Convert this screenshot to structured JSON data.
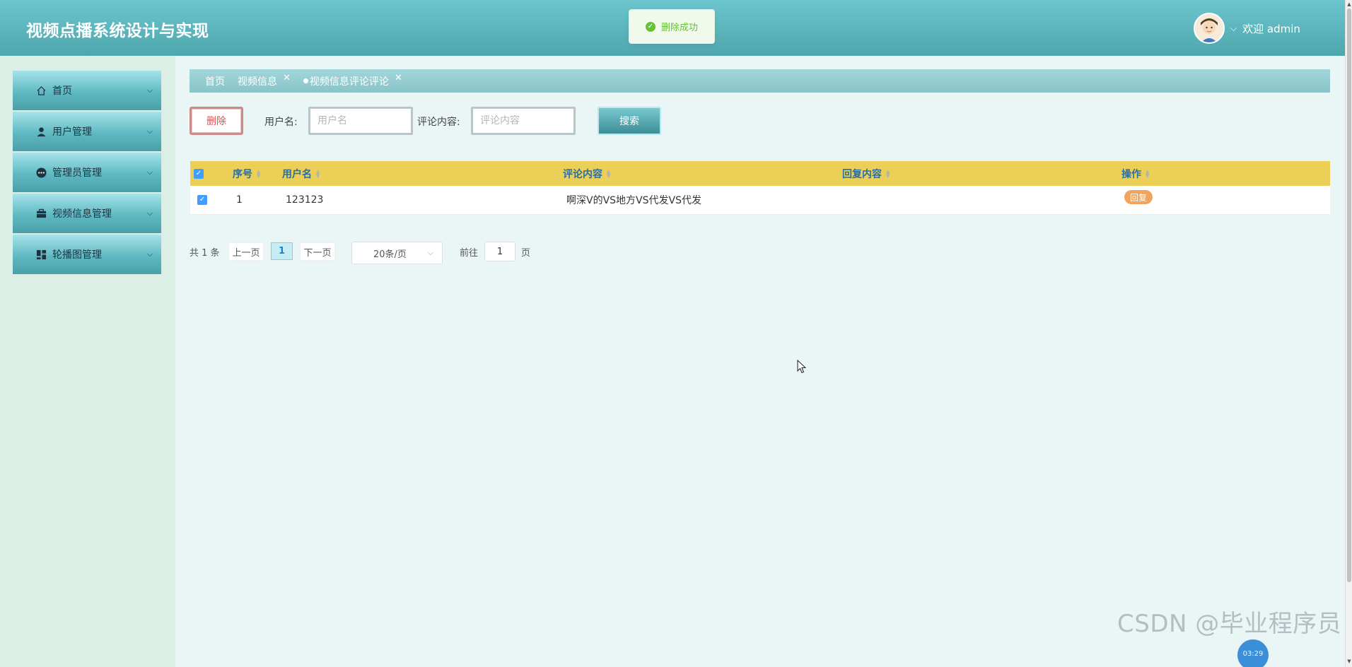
{
  "header": {
    "title": "视频点播系统设计与实现",
    "toast": "删除成功",
    "welcome": "欢迎 admin"
  },
  "sidebar": {
    "items": [
      {
        "label": "首页",
        "icon": "home-icon"
      },
      {
        "label": "用户管理",
        "icon": "user-icon"
      },
      {
        "label": "管理员管理",
        "icon": "more-icon"
      },
      {
        "label": "视频信息管理",
        "icon": "briefcase-icon"
      },
      {
        "label": "轮播图管理",
        "icon": "dashboard-icon"
      }
    ]
  },
  "tabs": [
    {
      "label": "首页",
      "closable": false
    },
    {
      "label": "视频信息",
      "closable": true
    },
    {
      "label": "视频信息评论评论",
      "closable": true,
      "active": true
    }
  ],
  "toolbar": {
    "delete_label": "删除",
    "username_label": "用户名:",
    "username_placeholder": "用户名",
    "content_label": "评论内容:",
    "content_placeholder": "评论内容",
    "search_label": "搜索"
  },
  "table": {
    "columns": [
      "序号",
      "用户名",
      "评论内容",
      "回复内容",
      "操作"
    ],
    "rows": [
      {
        "index": "1",
        "username": "123123",
        "content": "啊深V的VS地方VS代发VS代发",
        "reply": "",
        "action": "回复",
        "checked": true
      }
    ]
  },
  "pagination": {
    "total": "共 1 条",
    "prev": "上一页",
    "current": "1",
    "next": "下一页",
    "page_size": "20条/页",
    "goto_label": "前往",
    "goto_value": "1",
    "page_suffix": "页"
  },
  "watermark": "CSDN @毕业程序员",
  "corner_bubble": "03:29",
  "colors": {
    "header": "#5bb6be",
    "table_header": "#ebcf56",
    "reply_button": "#f0a45d",
    "toast_success": "#67c23a"
  }
}
